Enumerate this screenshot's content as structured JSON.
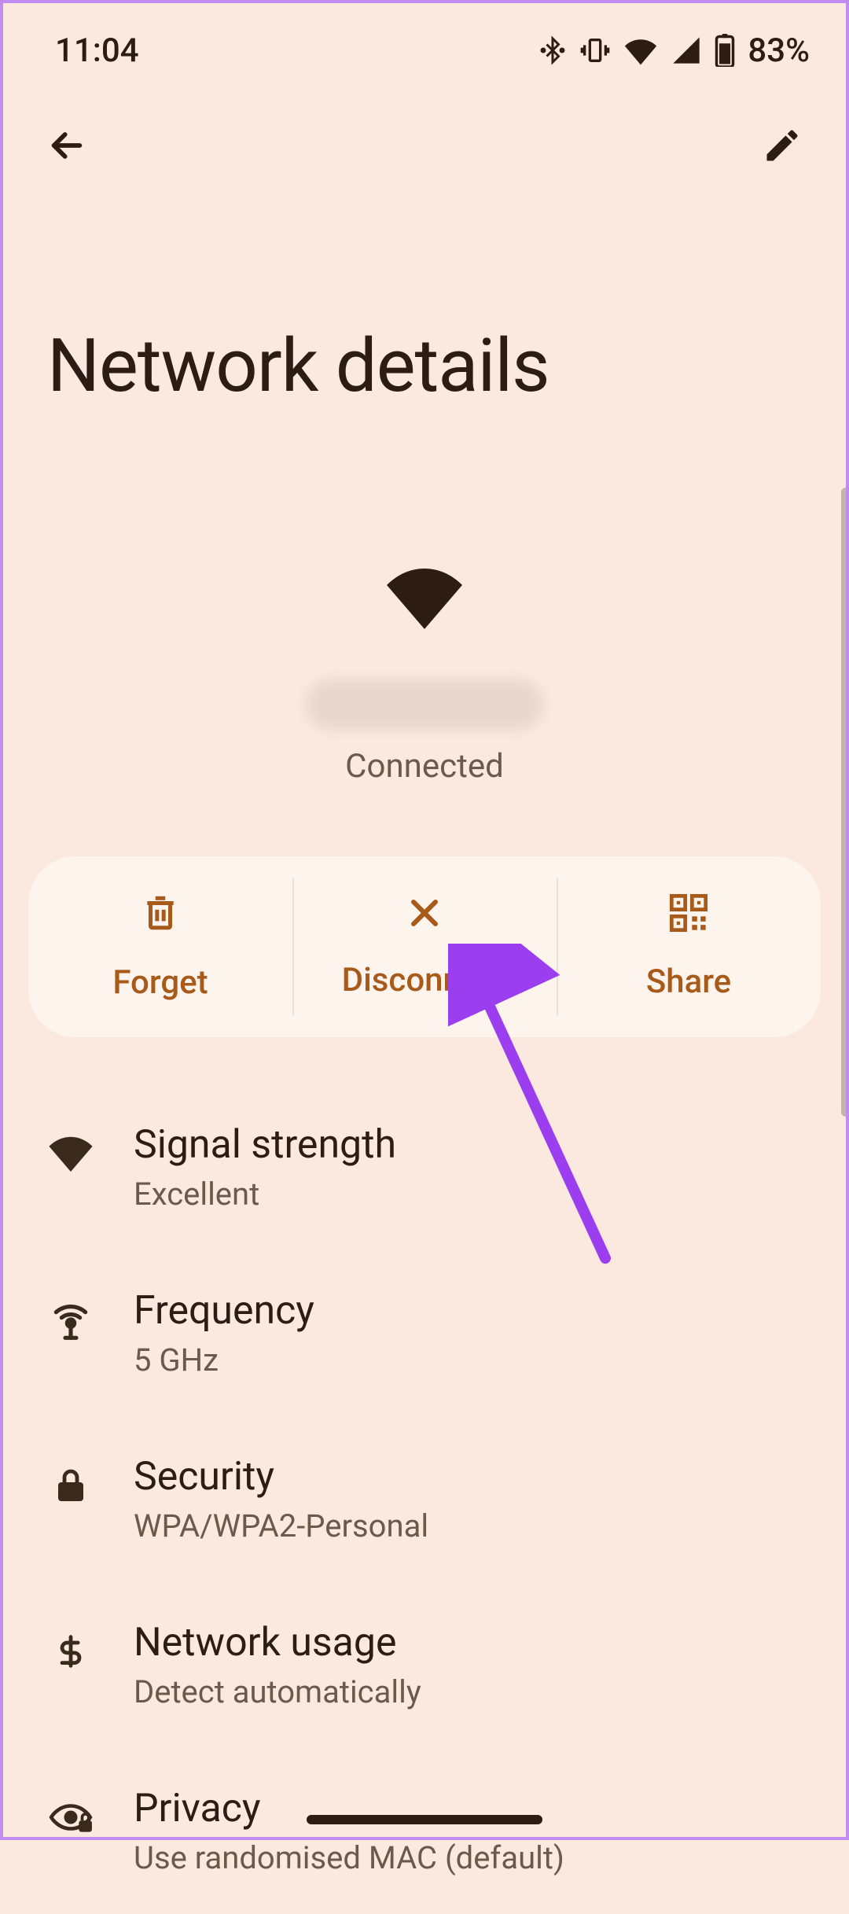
{
  "status_bar": {
    "time": "11:04",
    "battery_pct": "83%"
  },
  "page": {
    "title": "Network details",
    "connection_status": "Connected"
  },
  "actions": {
    "forget": "Forget",
    "disconnect": "Disconnect",
    "share": "Share"
  },
  "rows": {
    "signal": {
      "title": "Signal strength",
      "value": "Excellent"
    },
    "frequency": {
      "title": "Frequency",
      "value": "5 GHz"
    },
    "security": {
      "title": "Security",
      "value": "WPA/WPA2-Personal"
    },
    "usage": {
      "title": "Network usage",
      "value": "Detect automatically"
    },
    "privacy": {
      "title": "Privacy",
      "value": "Use randomised MAC (default)"
    }
  }
}
